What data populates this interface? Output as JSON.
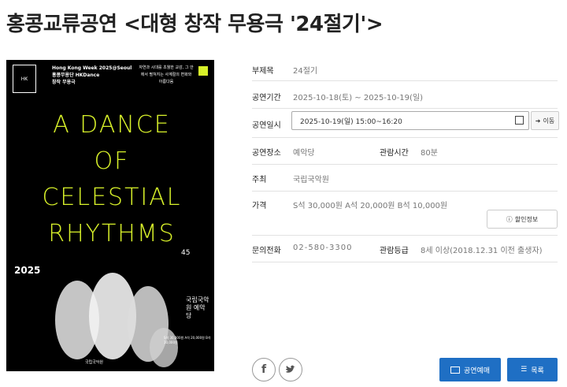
{
  "page_title": "홍콩교류공연 <대형 창작 무용극 '24절기'>",
  "poster": {
    "logo": "HK",
    "header": "Hong Kong Week 2025@Seoul",
    "org": "홍콩무용단 HKDance",
    "genre": "창작 무용극",
    "tagline": "자연과 시대를 초월한 교감, 그 안에서 펼쳐지는 사계절의 변화와 아름다움",
    "big_lines": [
      "A DANCE",
      "OF",
      "CELESTIAL",
      "RHYTHMS"
    ],
    "year": "2025",
    "dates": "10 18 · 19",
    "venue": "국립국악원 예악당",
    "badge": "45",
    "prices": "S석 30,000원 A석 20,000원 B석 10,000원",
    "footer_org": "국립국악원"
  },
  "details": {
    "subtitle_label": "부제목",
    "subtitle_value": "24절기",
    "period_label": "공연기간",
    "period_value": "2025-10-18(토) ~ 2025-10-19(일)",
    "datetime_label": "공연일시",
    "datetime_value": "2025-10-19(일) 15:00~16:20",
    "move_button": "이동",
    "place_label": "공연장소",
    "place_value": "예악당",
    "runtime_label": "관람시간",
    "runtime_value": "80분",
    "host_label": "주최",
    "host_value": "국립국악원",
    "price_label": "가격",
    "price_value": "S석 30,000원 A석 20,000원 B석 10,000원",
    "discount_button": "할인정보",
    "contact_label": "문의전화",
    "contact_value": "02-580-3300",
    "rating_label": "관람등급",
    "rating_value": "8세 이상(2018.12.31 이전 출생자)"
  },
  "actions": {
    "facebook_icon": "facebook-icon",
    "twitter_icon": "twitter-icon",
    "reserve_button": "공연예매",
    "list_button": "목록"
  }
}
